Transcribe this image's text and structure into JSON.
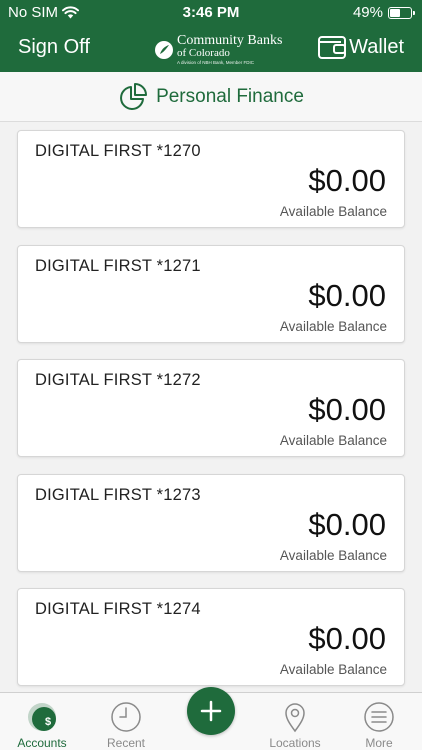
{
  "status_bar": {
    "carrier": "No SIM",
    "time": "3:46 PM",
    "battery_text": "49%",
    "battery_level": 0.49
  },
  "nav": {
    "sign_off_label": "Sign Off",
    "logo_line1": "Community Banks",
    "logo_line2": "of Colorado",
    "logo_line3": "A division of NBH Bank, Member FDIC",
    "wallet_label": "Wallet"
  },
  "personal_finance": {
    "label": "Personal Finance"
  },
  "accounts": [
    {
      "name": "DIGITAL FIRST *1270",
      "balance": "$0.00",
      "balance_label": "Available Balance"
    },
    {
      "name": "DIGITAL FIRST *1271",
      "balance": "$0.00",
      "balance_label": "Available Balance"
    },
    {
      "name": "DIGITAL FIRST *1272",
      "balance": "$0.00",
      "balance_label": "Available Balance"
    },
    {
      "name": "DIGITAL FIRST *1273",
      "balance": "$0.00",
      "balance_label": "Available Balance"
    },
    {
      "name": "DIGITAL FIRST *1274",
      "balance": "$0.00",
      "balance_label": "Available Balance"
    }
  ],
  "tab_bar": {
    "accounts_label": "Accounts",
    "recent_label": "Recent",
    "locations_label": "Locations",
    "more_label": "More",
    "accounts_badge": "$"
  },
  "colors": {
    "brand_green": "#1f6b3c",
    "inactive_gray": "#8a8a8a"
  }
}
